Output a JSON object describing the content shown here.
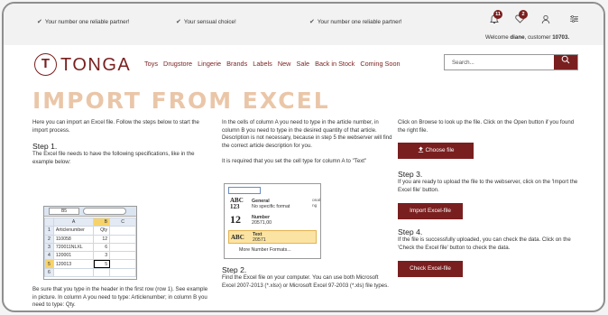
{
  "topbar": {
    "usp1": "Your number one reliable partner!",
    "usp2": "Your sensual choice!",
    "usp3": "Your number one reliable partner!",
    "badge_notifications": "11",
    "badge_wishlist": "2",
    "welcome_prefix": "Welcome ",
    "welcome_name": "diane",
    "welcome_mid": ", customer ",
    "welcome_number": "10703."
  },
  "header": {
    "logo_letter": "T",
    "logo_text": "TONGA",
    "nav": [
      "Toys",
      "Drugstore",
      "Lingerie",
      "Brands",
      "Labels",
      "New",
      "Sale",
      "Back in Stock",
      "Coming Soon"
    ],
    "search_placeholder": "Search..."
  },
  "page": {
    "title": "IMPORT FROM EXCEL",
    "intro": "Here you can import an Excel file. Follow the steps below to start the import process.",
    "step1_title": "Step 1.",
    "step1_text": "The Excel file needs to have the following specifications, like in the example below:",
    "step1_text2": "Be sure that you type in the header in the first row (row 1). See example in picture. In column A you need to type: Articlenumber; in column B you need to type: Qty.",
    "col2_text1": "In the cells of column A you need to type in the article number, in column B you need to type in the desired quantity of that article. Description is not necessary, because in step 5 the webserver will find the correct article description for you.",
    "col2_text2": "It is required that you set the cell type for column A to \"Text\"",
    "step2_title": "Step 2.",
    "step2_text": "Find the Excel file on your computer. You can use both Microsoft Excel 2007-2013 (*.xlsx) or Microsoft Excel 97-2003 (*.xls) file types.",
    "col3_text1": "Click on Browse to look up the file. Click on the Open button if you found the right file.",
    "choose_label": "Choose file",
    "step3_title": "Step 3.",
    "step3_text": "If you are ready to upload the file to the webserver, click on the 'Import the Excel file' button.",
    "import_label": "Import Excel-file",
    "step4_title": "Step 4.",
    "step4_text": "If the file is successfully uploaded, you can check the data. Click on the 'Check the Excel file' button to check the data.",
    "check_label": "Check Excel-file"
  },
  "excel1": {
    "namebox": "B5",
    "columns": [
      "A",
      "B",
      "C"
    ],
    "rows": [
      {
        "n": "1",
        "a": "Articlenumber",
        "b": "Qty"
      },
      {
        "n": "2",
        "a": "110058",
        "b": "12"
      },
      {
        "n": "3",
        "a": "720011NLXL",
        "b": "6"
      },
      {
        "n": "4",
        "a": "120001",
        "b": "3"
      },
      {
        "n": "5",
        "a": "120013",
        "b": "5"
      },
      {
        "n": "6",
        "a": "",
        "b": ""
      }
    ]
  },
  "excel2": {
    "opt1_icon": "ABC 123",
    "opt1_name": "General",
    "opt1_desc": "No specific format",
    "opt2_icon": "12",
    "opt2_name": "Number",
    "opt2_desc": "20571,00",
    "opt3_icon": "ABC",
    "opt3_name": "Text",
    "opt3_desc": "20571",
    "more": "More Number Formats...",
    "side1": "onal",
    "side2": "ng"
  }
}
